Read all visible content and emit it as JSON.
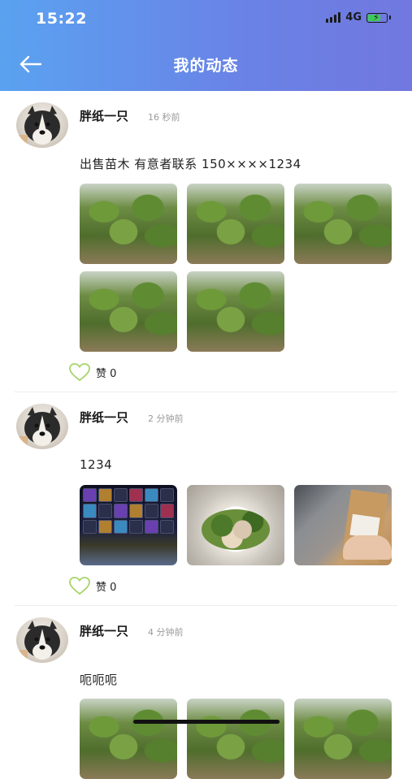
{
  "status_bar": {
    "time": "15:22",
    "network": "4G"
  },
  "header": {
    "title": "我的动态"
  },
  "posts": [
    {
      "user": "胖纸一只",
      "time": "16 秒前",
      "text": "出售苗木  有意者联系 150××××1234",
      "likes": "赞 0",
      "photos": [
        "tree",
        "tree",
        "tree",
        "tree",
        "tree"
      ]
    },
    {
      "user": "胖纸一只",
      "time": "2 分钟前",
      "text": "1234",
      "likes": "赞 0",
      "photos": [
        "game",
        "food",
        "box"
      ]
    },
    {
      "user": "胖纸一只",
      "time": "4 分钟前",
      "text": "呃呃呃",
      "likes": "",
      "photos": [
        "tree",
        "tree",
        "tree"
      ]
    }
  ],
  "colors": {
    "header_start": "#5aa2f0",
    "header_end": "#7178df",
    "like_outline": "#a6d46a"
  }
}
